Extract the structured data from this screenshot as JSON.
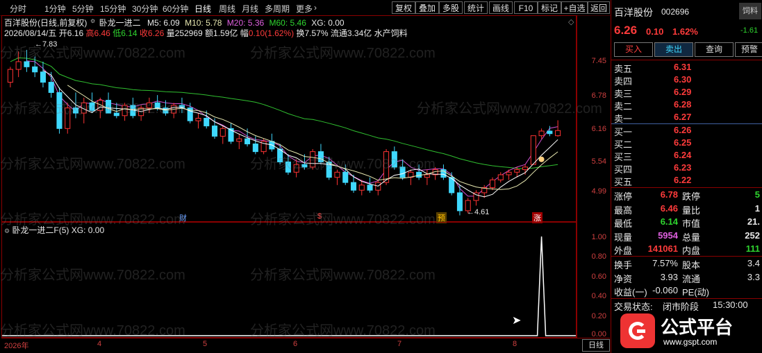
{
  "toolbar": {
    "periods": [
      "分时",
      "1分钟",
      "5分钟",
      "15分钟",
      "30分钟",
      "60分钟",
      "日线",
      "周线",
      "月线",
      "多周期",
      "更多"
    ],
    "more_arrow": "›",
    "buttons": [
      "复权",
      "叠加",
      "多股",
      "统计",
      "画线",
      "F10",
      "标记",
      "+自选",
      "返回"
    ]
  },
  "main_chart": {
    "stock_title": "百洋股份(日线,前复权)",
    "indicator_name": "卧龙一进二",
    "ma_values": {
      "m5": "M5: 6.09",
      "m10": "M10: 5.78",
      "m20": "M20: 5.36",
      "m60": "M60: 5.46",
      "xg": "XG: 0.00"
    },
    "info_line": {
      "date": "2026/08/14/五",
      "open_lbl": "开",
      "open": "6.16",
      "high_lbl": "高",
      "high": "6.46",
      "low_lbl": "低",
      "low": "6.14",
      "close_lbl": "收",
      "close": "6.26",
      "vol_lbl": "量",
      "vol": "252969",
      "amt_lbl": "额",
      "amt": "1.59亿",
      "amp_lbl": "幅",
      "amp": "0.10(1.62%)",
      "turn_lbl": "换",
      "turn": "7.57%",
      "float_lbl": "流通",
      "float": "3.34亿",
      "industry": "水产饲料"
    },
    "high_marker": "7.83",
    "low_marker": "4.61",
    "event_markers": {
      "cai": "财",
      "s": "$",
      "yu": "预",
      "zhang": "涨"
    },
    "price_ticks": [
      "7.45",
      "6.78",
      "6.16",
      "5.54",
      "4.99"
    ]
  },
  "sub_chart": {
    "title": "卧龙一进二F(5)",
    "xg": "XG: 0.00",
    "ticks": [
      "1.00",
      "0.80",
      "0.60",
      "0.40",
      "0.20",
      "0.00"
    ]
  },
  "date_axis": {
    "labels": [
      "2026年",
      "4",
      "5",
      "6",
      "7",
      "8"
    ],
    "period": "日线"
  },
  "right_panel": {
    "stock_name": "百洋股份",
    "stock_code": "002696",
    "tag": "饲料",
    "price": "6.26",
    "change": "0.10",
    "pct": "1.62%",
    "side_value": "-1.61",
    "actions": {
      "buy": "买入",
      "sell": "卖出",
      "query": "查询",
      "warn": "预警"
    },
    "asks": [
      {
        "label": "卖五",
        "price": "6.31"
      },
      {
        "label": "卖四",
        "price": "6.30"
      },
      {
        "label": "卖三",
        "price": "6.29"
      },
      {
        "label": "卖二",
        "price": "6.28"
      },
      {
        "label": "卖一",
        "price": "6.27"
      }
    ],
    "bids": [
      {
        "label": "买一",
        "price": "6.26"
      },
      {
        "label": "买二",
        "price": "6.25"
      },
      {
        "label": "买三",
        "price": "6.24"
      },
      {
        "label": "买四",
        "price": "6.23"
      },
      {
        "label": "买五",
        "price": "6.22"
      }
    ],
    "stats": [
      {
        "l1": "涨停",
        "v1": "6.78",
        "l2": "跌停",
        "v2": "5"
      },
      {
        "l1": "最高",
        "v1": "6.46",
        "l2": "量比",
        "v2": "1"
      },
      {
        "l1": "最低",
        "v1": "6.14",
        "l2": "市值",
        "v2": "21."
      },
      {
        "l1": "现量",
        "v1": "5954",
        "l2": "总量",
        "v2": "252"
      },
      {
        "l1": "外盘",
        "v1": "141061",
        "l2": "内盘",
        "v2": "111"
      }
    ],
    "stats2": [
      {
        "l1": "换手",
        "v1": "7.57%",
        "l2": "股本",
        "v2": "3.4"
      },
      {
        "l1": "净资",
        "v1": "3.93",
        "l2": "流通",
        "v2": "3.3"
      },
      {
        "l1": "收益(一)",
        "v1": "-0.060",
        "l2": "PE(动)",
        "v2": ""
      }
    ],
    "trade_status_lbl": "交易状态:",
    "trade_status": "闭市阶段",
    "trade_time": "15:30:00"
  },
  "branding": {
    "logo_text": "公式平台",
    "logo_url": "www.gspt.com"
  },
  "watermark_text": "分析家公式网www.70822.com",
  "chart_data": {
    "type": "candlestick",
    "ylim": [
      4.55,
      7.95
    ],
    "ma": {
      "m5": "#ffffff",
      "m10": "#e8e8b0",
      "m20": "#d050d0",
      "m60": "#30c030"
    },
    "candles": [
      [
        7.2,
        7.5,
        7.1,
        7.45
      ],
      [
        7.45,
        7.8,
        7.3,
        7.6
      ],
      [
        7.6,
        7.83,
        7.4,
        7.5
      ],
      [
        7.5,
        7.7,
        7.3,
        7.4
      ],
      [
        7.4,
        7.6,
        7.1,
        7.2
      ],
      [
        7.2,
        7.4,
        6.9,
        7.0
      ],
      [
        7.0,
        7.1,
        6.2,
        6.3
      ],
      [
        6.3,
        6.8,
        6.2,
        6.7
      ],
      [
        6.7,
        7.0,
        6.5,
        6.6
      ],
      [
        6.6,
        6.9,
        6.4,
        6.8
      ],
      [
        6.8,
        7.0,
        6.6,
        6.65
      ],
      [
        6.65,
        6.9,
        6.5,
        6.85
      ],
      [
        6.85,
        7.0,
        6.6,
        6.6
      ],
      [
        6.6,
        6.8,
        6.5,
        6.55
      ],
      [
        6.55,
        6.8,
        6.45,
        6.75
      ],
      [
        6.75,
        6.9,
        6.5,
        6.55
      ],
      [
        6.55,
        6.75,
        6.45,
        6.7
      ],
      [
        6.7,
        6.9,
        6.6,
        6.8
      ],
      [
        6.8,
        6.95,
        6.65,
        6.7
      ],
      [
        6.7,
        6.85,
        6.55,
        6.6
      ],
      [
        6.6,
        6.8,
        6.5,
        6.75
      ],
      [
        6.75,
        6.9,
        6.6,
        6.7
      ],
      [
        6.7,
        6.8,
        6.4,
        6.45
      ],
      [
        6.45,
        6.6,
        6.3,
        6.5
      ],
      [
        6.5,
        6.65,
        6.3,
        6.35
      ],
      [
        6.35,
        6.5,
        6.1,
        6.15
      ],
      [
        6.15,
        6.35,
        6.0,
        6.3
      ],
      [
        6.3,
        6.4,
        6.0,
        6.05
      ],
      [
        6.05,
        6.2,
        5.9,
        6.1
      ],
      [
        6.1,
        6.3,
        5.95,
        6.0
      ],
      [
        6.0,
        6.15,
        5.8,
        5.85
      ],
      [
        5.85,
        6.1,
        5.8,
        6.05
      ],
      [
        6.05,
        6.2,
        5.85,
        5.9
      ],
      [
        5.9,
        6.0,
        5.6,
        5.65
      ],
      [
        5.65,
        5.8,
        5.4,
        5.45
      ],
      [
        5.45,
        5.7,
        5.35,
        5.6
      ],
      [
        5.6,
        5.8,
        5.5,
        5.55
      ],
      [
        5.55,
        5.9,
        5.5,
        5.85
      ],
      [
        5.85,
        6.0,
        5.6,
        5.65
      ],
      [
        5.65,
        5.75,
        5.3,
        5.35
      ],
      [
        5.35,
        5.5,
        5.2,
        5.45
      ],
      [
        5.45,
        5.6,
        5.2,
        5.25
      ],
      [
        5.25,
        5.4,
        5.05,
        5.1
      ],
      [
        5.1,
        5.3,
        5.0,
        5.2
      ],
      [
        5.2,
        5.35,
        5.05,
        5.1
      ],
      [
        5.1,
        5.3,
        5.0,
        5.25
      ],
      [
        5.25,
        5.9,
        5.2,
        5.85
      ],
      [
        5.85,
        5.95,
        5.5,
        5.55
      ],
      [
        5.55,
        5.7,
        5.3,
        5.35
      ],
      [
        5.35,
        5.5,
        5.2,
        5.45
      ],
      [
        5.45,
        5.6,
        5.3,
        5.35
      ],
      [
        5.35,
        5.5,
        5.2,
        5.4
      ],
      [
        5.4,
        5.55,
        5.3,
        5.5
      ],
      [
        5.5,
        5.6,
        5.3,
        5.35
      ],
      [
        5.35,
        5.45,
        5.0,
        5.05
      ],
      [
        5.05,
        5.2,
        4.61,
        4.7
      ],
      [
        4.7,
        4.95,
        4.65,
        4.9
      ],
      [
        4.9,
        5.1,
        4.8,
        5.05
      ],
      [
        5.05,
        5.2,
        4.95,
        5.15
      ],
      [
        5.15,
        5.35,
        5.1,
        5.3
      ],
      [
        5.3,
        5.45,
        5.25,
        5.4
      ],
      [
        5.4,
        5.5,
        5.3,
        5.45
      ],
      [
        5.45,
        5.55,
        5.35,
        5.5
      ],
      [
        5.5,
        5.6,
        5.4,
        5.55
      ],
      [
        5.6,
        6.16,
        5.6,
        6.16
      ],
      [
        6.16,
        6.3,
        6.1,
        6.25
      ],
      [
        6.25,
        6.35,
        6.15,
        6.2
      ],
      [
        6.16,
        6.46,
        6.14,
        6.26
      ]
    ],
    "signal": {
      "index": 65,
      "value": 1.0
    }
  }
}
